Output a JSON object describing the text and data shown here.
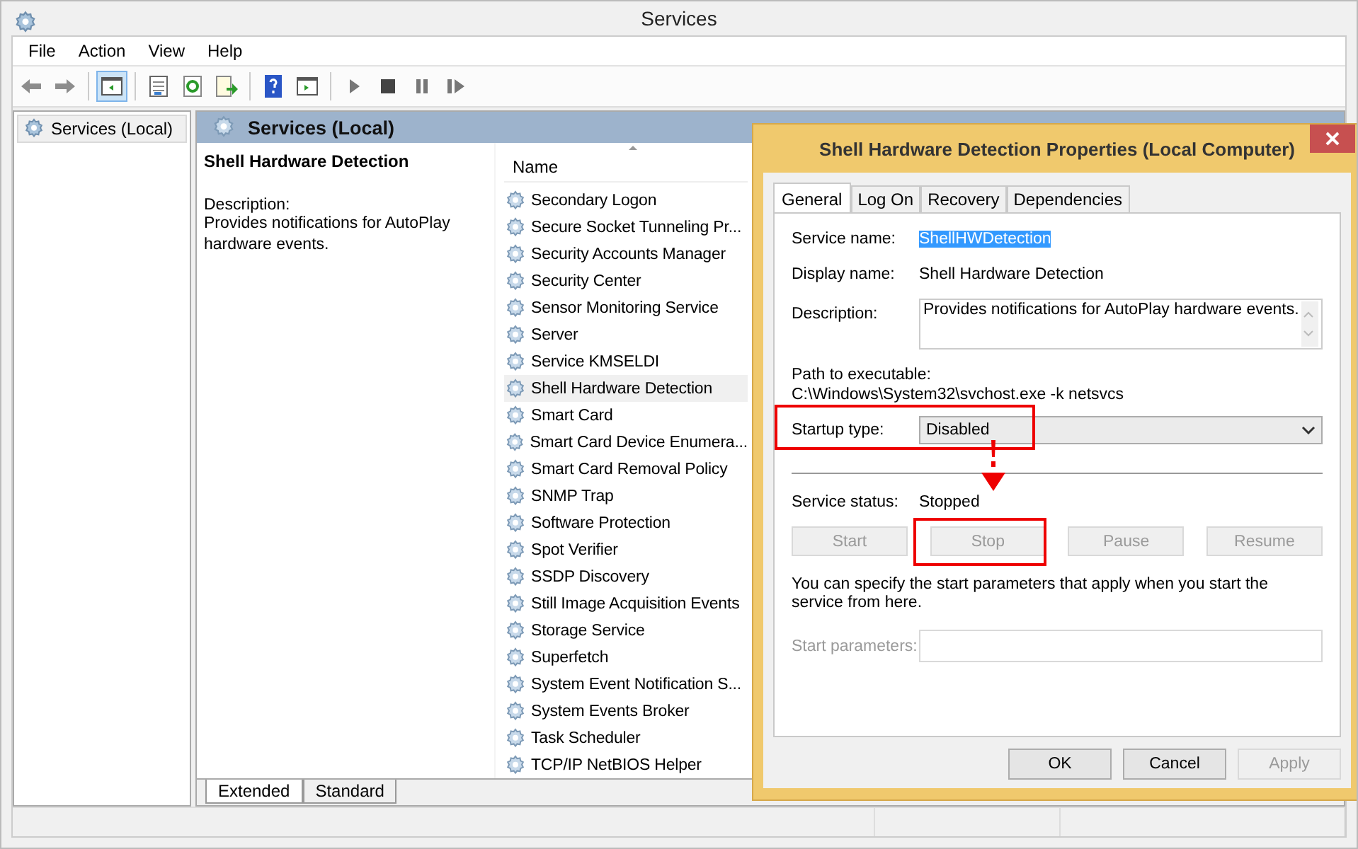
{
  "window": {
    "title": "Services"
  },
  "menu": [
    "File",
    "Action",
    "View",
    "Help"
  ],
  "toolbar": [
    {
      "kind": "back",
      "selected": false
    },
    {
      "kind": "forward",
      "selected": false
    },
    {
      "kind": "tree",
      "selected": true
    },
    {
      "kind": "properties",
      "selected": false
    },
    {
      "kind": "refresh",
      "selected": false
    },
    {
      "kind": "export",
      "selected": false
    },
    {
      "kind": "help",
      "selected": false
    },
    {
      "kind": "console",
      "selected": false
    },
    {
      "kind": "play",
      "selected": false
    },
    {
      "kind": "stop",
      "selected": false
    },
    {
      "kind": "pause",
      "selected": false
    },
    {
      "kind": "resume",
      "selected": false
    }
  ],
  "tree": {
    "items": [
      {
        "label": "Services (Local)",
        "selected": true
      }
    ]
  },
  "panel": {
    "header": "Services (Local)",
    "service_title": "Shell Hardware Detection",
    "description_label": "Description:",
    "description": "Provides notifications for AutoPlay hardware events."
  },
  "list": {
    "column": "Name",
    "rows": [
      {
        "name": "Secondary Logon",
        "selected": false
      },
      {
        "name": "Secure Socket Tunneling Pr...",
        "selected": false
      },
      {
        "name": "Security Accounts Manager",
        "selected": false
      },
      {
        "name": "Security Center",
        "selected": false
      },
      {
        "name": "Sensor Monitoring Service",
        "selected": false
      },
      {
        "name": "Server",
        "selected": false
      },
      {
        "name": "Service KMSELDI",
        "selected": false
      },
      {
        "name": "Shell Hardware Detection",
        "selected": true
      },
      {
        "name": "Smart Card",
        "selected": false
      },
      {
        "name": "Smart Card Device Enumera...",
        "selected": false
      },
      {
        "name": "Smart Card Removal Policy",
        "selected": false
      },
      {
        "name": "SNMP Trap",
        "selected": false
      },
      {
        "name": "Software Protection",
        "selected": false
      },
      {
        "name": "Spot Verifier",
        "selected": false
      },
      {
        "name": "SSDP Discovery",
        "selected": false
      },
      {
        "name": "Still Image Acquisition Events",
        "selected": false
      },
      {
        "name": "Storage Service",
        "selected": false
      },
      {
        "name": "Superfetch",
        "selected": false
      },
      {
        "name": "System Event Notification S...",
        "selected": false
      },
      {
        "name": "System Events Broker",
        "selected": false
      },
      {
        "name": "Task Scheduler",
        "selected": false
      },
      {
        "name": "TCP/IP NetBIOS Helper",
        "selected": false
      }
    ]
  },
  "bottom_tabs": [
    {
      "label": "Extended",
      "selected": true
    },
    {
      "label": "Standard",
      "selected": false
    }
  ],
  "dialog": {
    "title": "Shell Hardware Detection Properties (Local Computer)",
    "tabs": [
      {
        "label": "General",
        "selected": true
      },
      {
        "label": "Log On",
        "selected": false
      },
      {
        "label": "Recovery",
        "selected": false
      },
      {
        "label": "Dependencies",
        "selected": false
      }
    ],
    "service_name_label": "Service name:",
    "service_name": "ShellHWDetection",
    "display_name_label": "Display name:",
    "display_name": "Shell Hardware Detection",
    "description_label": "Description:",
    "description": "Provides notifications for AutoPlay hardware events.",
    "path_label": "Path to executable:",
    "path": "C:\\Windows\\System32\\svchost.exe -k netsvcs",
    "startup_label": "Startup type:",
    "startup_value": "Disabled",
    "status_label": "Service status:",
    "status_value": "Stopped",
    "service_buttons": [
      {
        "label": "Start",
        "disabled": true
      },
      {
        "label": "Stop",
        "disabled": true
      },
      {
        "label": "Pause",
        "disabled": true
      },
      {
        "label": "Resume",
        "disabled": true
      }
    ],
    "hint": "You can specify the start parameters that apply when you start the service from here.",
    "params_label": "Start parameters:",
    "params_disabled": true,
    "buttons": [
      {
        "label": "OK",
        "disabled": false
      },
      {
        "label": "Cancel",
        "disabled": false
      },
      {
        "label": "Apply",
        "disabled": true
      }
    ]
  }
}
